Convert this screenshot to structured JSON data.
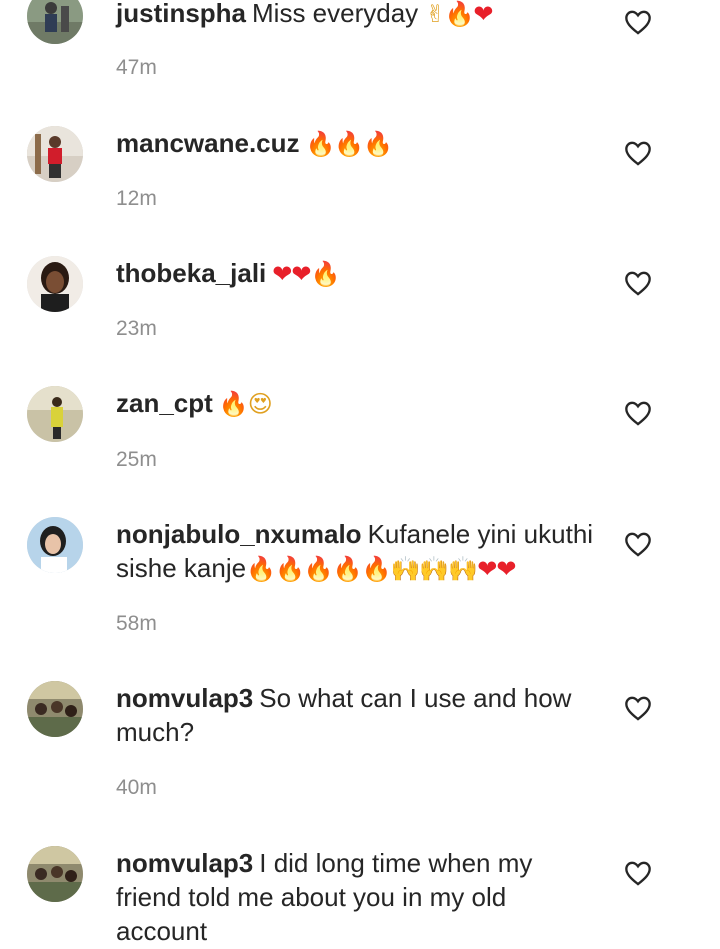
{
  "colors": {
    "text": "#262626",
    "meta": "#8e8e8e",
    "heart_outline": "#262626",
    "fire": "#f57c00",
    "heart_red": "#e8202a"
  },
  "comments": [
    {
      "username": "justinspha",
      "text": "Miss everyday",
      "emoji": "✌🔥❤",
      "time": "47m",
      "avatar_icon": "avatar-photo",
      "like_icon": "heart-outline-icon"
    },
    {
      "username": "mancwane.cuz",
      "text": "",
      "emoji": "🔥🔥🔥",
      "time": "12m",
      "avatar_icon": "avatar-photo",
      "like_icon": "heart-outline-icon"
    },
    {
      "username": "thobeka_jali",
      "text": "",
      "emoji": "❤❤🔥",
      "time": "23m",
      "avatar_icon": "avatar-photo",
      "like_icon": "heart-outline-icon"
    },
    {
      "username": "zan_cpt",
      "text": "",
      "emoji": "🔥😍",
      "time": "25m",
      "avatar_icon": "avatar-photo",
      "like_icon": "heart-outline-icon"
    },
    {
      "username": "nonjabulo_nxumalo",
      "text": "Kufanele yini ukuthi sishe kanje",
      "emoji": "🔥🔥🔥🔥🔥🙌🙌🙌❤❤",
      "time": "58m",
      "avatar_icon": "avatar-photo",
      "like_icon": "heart-outline-icon"
    },
    {
      "username": "nomvulap3",
      "text": "So what can I use and how much?",
      "emoji": "",
      "time": "40m",
      "avatar_icon": "avatar-photo",
      "like_icon": "heart-outline-icon"
    },
    {
      "username": "nomvulap3",
      "text": "I did long time when my friend told me about you in my old account",
      "emoji": "",
      "time": "",
      "avatar_icon": "avatar-photo",
      "like_icon": "heart-outline-icon"
    }
  ]
}
